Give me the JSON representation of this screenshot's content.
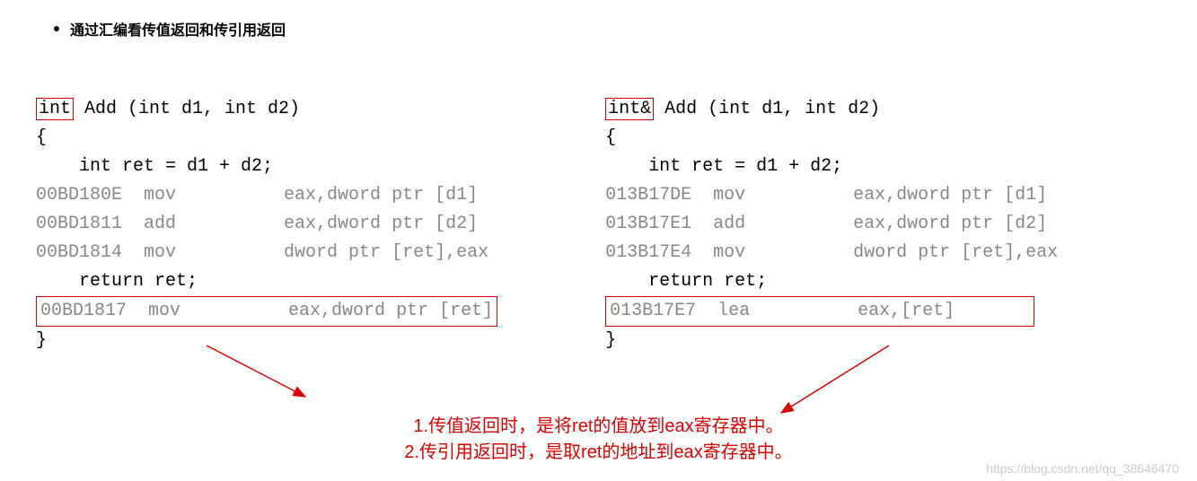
{
  "bullet": "通过汇编看传值返回和传引用返回",
  "left": {
    "ret_type": "int",
    "sig_rest": " Add (int d1, int d2)",
    "brace_open": "{",
    "body_line": "    int ret = d1 + d2;",
    "asm": [
      "00BD180E  mov          eax,dword ptr [d1]",
      "00BD1811  add          eax,dword ptr [d2]",
      "00BD1814  mov          dword ptr [ret],eax"
    ],
    "return_line": "    return ret;",
    "asm_return": "00BD1817  mov          eax,dword ptr [ret]",
    "brace_close": "}"
  },
  "right": {
    "ret_type": "int&",
    "sig_rest": " Add (int d1, int d2)",
    "brace_open": "{",
    "body_line": "    int ret = d1 + d2;",
    "asm": [
      "013B17DE  mov          eax,dword ptr [d1]",
      "013B17E1  add          eax,dword ptr [d2]",
      "013B17E4  mov          dword ptr [ret],eax"
    ],
    "return_line": "    return ret;",
    "asm_return": "013B17E7  lea          eax,[ret]       ",
    "brace_close": "}"
  },
  "annot1": "1.传值返回时，是将ret的值放到eax寄存器中。",
  "annot2": "2.传引用返回时，是取ret的地址到eax寄存器中。",
  "watermark": "https://blog.csdn.net/qq_38646470"
}
